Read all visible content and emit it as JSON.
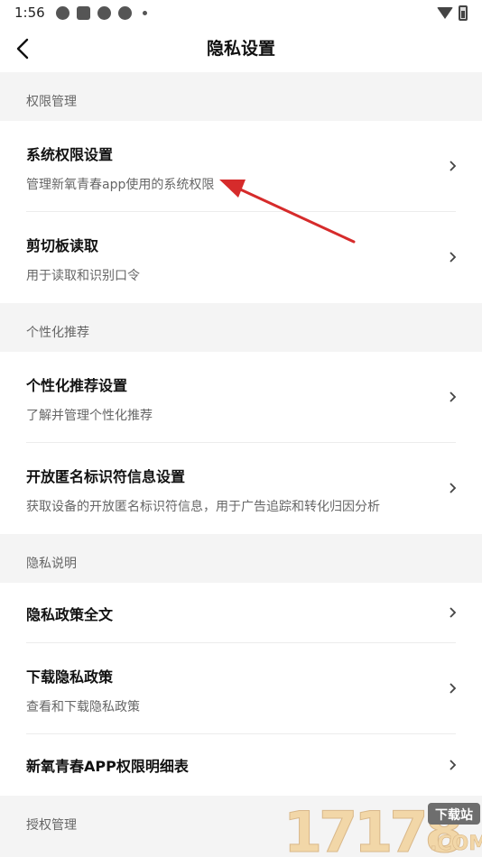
{
  "status_bar": {
    "time": "1:56"
  },
  "header": {
    "title": "隐私设置"
  },
  "sections": [
    {
      "title": "权限管理",
      "items": [
        {
          "title": "系统权限设置",
          "subtitle": "管理新氧青春app使用的系统权限"
        },
        {
          "title": "剪切板读取",
          "subtitle": "用于读取和识别口令"
        }
      ]
    },
    {
      "title": "个性化推荐",
      "items": [
        {
          "title": "个性化推荐设置",
          "subtitle": "了解并管理个性化推荐"
        },
        {
          "title": "开放匿名标识符信息设置",
          "subtitle": "获取设备的开放匿名标识符信息，用于广告追踪和转化归因分析"
        }
      ]
    },
    {
      "title": "隐私说明",
      "items": [
        {
          "title": "隐私政策全文"
        },
        {
          "title": "下载隐私政策",
          "subtitle": "查看和下载隐私政策"
        },
        {
          "title": "新氧青春APP权限明细表"
        }
      ]
    },
    {
      "title": "授权管理"
    }
  ],
  "colors": {
    "annotation_arrow": "#d62b2b",
    "background": "#f4f4f4",
    "card": "#ffffff"
  },
  "watermark": {
    "logo_text": "17178",
    "badge": "下载站",
    "suffix": ".com"
  }
}
